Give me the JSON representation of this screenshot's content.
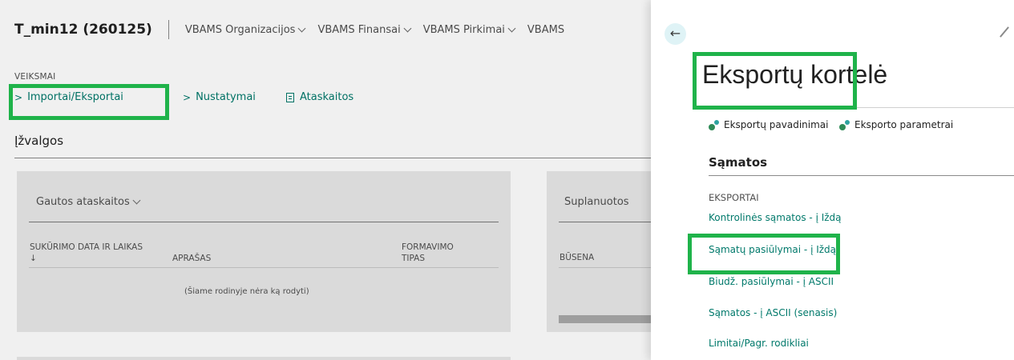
{
  "header": {
    "company": "T_min12 (260125)",
    "nav": [
      "VBAMS Organizacijos",
      "VBAMS Finansai",
      "VBAMS Pirkimai",
      "VBAMS"
    ]
  },
  "actions": {
    "group_label": "VEIKSMAI",
    "imports_exports": "Importai/Eksportai",
    "settings": "Nustatymai",
    "reports": "Ataskaitos"
  },
  "insights": {
    "title": "Įžvalgos"
  },
  "received_reports": {
    "title": "Gautos ataskaitos",
    "columns": [
      "SUKŪRIMO DATA IR LAIKAS ↓",
      "APRAŠAS",
      "FORMAVIMO TIPAS"
    ],
    "empty_text": "(Šiame rodinyje nėra ką rodyti)"
  },
  "scheduled": {
    "title": "Suplanuotos",
    "column": "BŪSENA"
  },
  "panel": {
    "back_icon": "arrow-left-icon",
    "title": "Eksportų kortelė",
    "links": [
      "Eksportų pavadinimai",
      "Eksporto parametrai"
    ],
    "section": "Sąmatos",
    "group": "EKSPORTAI",
    "items": [
      "Kontrolinės sąmatos - į Iždą",
      "Sąmatų pasiūlymai - į Iždą",
      "Biudž. pasiūlymai - į ASCII",
      "Sąmatos - į ASCII (senasis)",
      "Limitai/Pagr. rodikliai"
    ]
  },
  "colors": {
    "accent": "#00796b",
    "highlight": "#1fb34a",
    "card_bg": "#e8e8e8"
  }
}
